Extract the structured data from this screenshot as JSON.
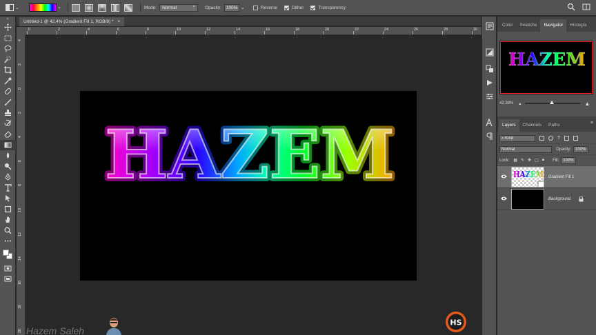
{
  "options_bar": {
    "mode_label": "Mode:",
    "mode_value": "Normal",
    "opacity_label": "Opacity:",
    "opacity_value": "100%",
    "reverse_label": "Reverse",
    "reverse_checked": false,
    "dither_label": "Dither",
    "dither_checked": true,
    "transparency_label": "Transparency",
    "transparency_checked": true
  },
  "document": {
    "tab_title": "Untitled-1 @ 42.4% (Gradient Fill 1, RGB/8) *",
    "close_glyph": "×",
    "artwork_text": "HAZEM"
  },
  "ruler_top": [
    "0",
    "2",
    "4",
    "6",
    "8",
    "10",
    "12",
    "14",
    "16",
    "18",
    "20",
    "22",
    "24",
    "26",
    "28",
    "30"
  ],
  "ruler_left": [
    "4",
    "2",
    "0",
    "2",
    "4",
    "6",
    "8",
    "10",
    "12",
    "14",
    "16",
    "18",
    "20"
  ],
  "navigator_panel": {
    "tabs": [
      "Color",
      "Swatche",
      "Navigator",
      "Histogra"
    ],
    "active_tab": "Navigator",
    "zoom_value": "42.38%"
  },
  "layers_panel": {
    "tabs": [
      "Layers",
      "Channels",
      "Paths"
    ],
    "active_tab": "Layers",
    "filter_kind": "Kind",
    "blend_mode": "Normal",
    "opacity_label": "Opacity:",
    "opacity_value": "100%",
    "lock_label": "Lock:",
    "fill_label": "Fill:",
    "fill_value": "100%",
    "layers": [
      {
        "name": "Gradient Fill 1",
        "selected": true,
        "visible": true
      },
      {
        "name": "Background",
        "selected": false,
        "visible": true,
        "locked": true
      }
    ]
  },
  "watermark": {
    "text": "Hazem Saleh",
    "logo_text": "HS"
  },
  "colors": {
    "foreground": "#ffffff",
    "background": "#ffffff",
    "canvas": "#000000",
    "selected_layer": "#6f6f6f"
  }
}
